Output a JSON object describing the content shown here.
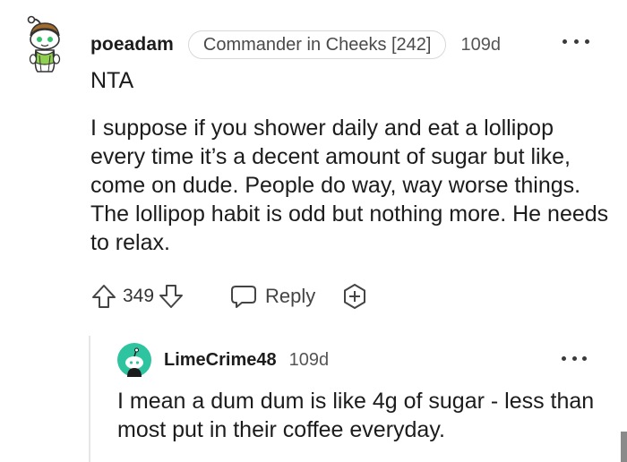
{
  "comment": {
    "username": "poeadam",
    "flair": "Commander in Cheeks [242]",
    "timestamp": "109d",
    "verdict": "NTA",
    "body": "I suppose if you shower daily and eat a lollipop every time it’s a decent amount of sugar but like, come on dude. People do way, way worse things. The lollipop habit is odd but nothing more. He needs to relax.",
    "votes": "349",
    "reply_label": "Reply",
    "icons": {
      "avatar": "snoo-avatar-icon",
      "more": "more-options-icon",
      "upvote": "upvote-arrow-icon",
      "downvote": "downvote-arrow-icon",
      "reply": "reply-bubble-icon",
      "award": "add-award-icon"
    }
  },
  "reply": {
    "username": "LimeCrime48",
    "timestamp": "109d",
    "body": "I mean a dum dum is like 4g of sugar - less than most put in their coffee everyday.",
    "icons": {
      "avatar": "snoo-avatar-icon",
      "more": "more-options-icon"
    }
  },
  "colors": {
    "text": "#1c1c1c",
    "meta": "#555555",
    "flair_border": "#d8d8d8",
    "thread_line": "#e6e6e6",
    "reply_avatar": "#2ec4a0"
  }
}
